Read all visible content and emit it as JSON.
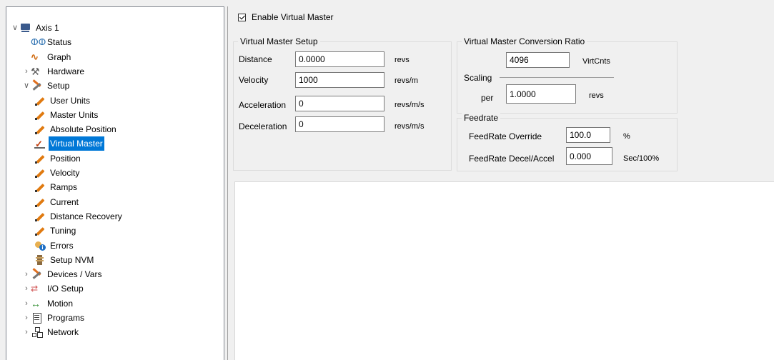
{
  "tree": {
    "items": [
      {
        "label": "Axis 1",
        "chevron": "expanded",
        "icon": "axis-icon"
      },
      {
        "label": "Status",
        "chevron": "",
        "icon": "glasses-icon"
      },
      {
        "label": "Graph",
        "chevron": "",
        "icon": "graph-icon"
      },
      {
        "label": "Hardware",
        "chevron": "collapsed",
        "icon": "hardware-icon"
      },
      {
        "label": "Setup",
        "chevron": "expanded",
        "icon": "setup-tools-icon"
      },
      {
        "label": "User Units",
        "chevron": "",
        "icon": "pen-icon"
      },
      {
        "label": "Master Units",
        "chevron": "",
        "icon": "pen-icon"
      },
      {
        "label": "Absolute Position",
        "chevron": "",
        "icon": "pen-icon"
      },
      {
        "label": "Virtual Master",
        "chevron": "",
        "icon": "virtual-master-icon",
        "selected": true
      },
      {
        "label": "Position",
        "chevron": "",
        "icon": "pen-icon"
      },
      {
        "label": "Velocity",
        "chevron": "",
        "icon": "pen-icon"
      },
      {
        "label": "Ramps",
        "chevron": "",
        "icon": "pen-icon"
      },
      {
        "label": "Current",
        "chevron": "",
        "icon": "pen-icon"
      },
      {
        "label": "Distance Recovery",
        "chevron": "",
        "icon": "pen-icon"
      },
      {
        "label": "Tuning",
        "chevron": "",
        "icon": "pen-icon"
      },
      {
        "label": "Errors",
        "chevron": "",
        "icon": "errors-info-icon"
      },
      {
        "label": "Setup NVM",
        "chevron": "",
        "icon": "nvm-icon"
      },
      {
        "label": "Devices / Vars",
        "chevron": "collapsed",
        "icon": "setup-tools-icon"
      },
      {
        "label": "I/O Setup",
        "chevron": "collapsed",
        "icon": "io-icon"
      },
      {
        "label": "Motion",
        "chevron": "collapsed",
        "icon": "motion-arrows-icon"
      },
      {
        "label": "Programs",
        "chevron": "collapsed",
        "icon": "programs-icon"
      },
      {
        "label": "Network",
        "chevron": "collapsed",
        "icon": "network-icon"
      }
    ]
  },
  "enable_virtual_master": {
    "label": "Enable Virtual Master",
    "checked": true
  },
  "setup": {
    "title": "Virtual Master Setup",
    "distance": {
      "label": "Distance",
      "value": "0.0000",
      "unit": "revs"
    },
    "velocity": {
      "label": "Velocity",
      "value": "1000",
      "unit": "revs/m"
    },
    "acceleration": {
      "label": "Acceleration",
      "value": "0",
      "unit": "revs/m/s"
    },
    "deceleration": {
      "label": "Deceleration",
      "value": "0",
      "unit": "revs/m/s"
    }
  },
  "conversion": {
    "title": "Virtual Master Conversion Ratio",
    "numerator": {
      "value": "4096",
      "unit": "VirtCnts"
    },
    "scaling_label": "Scaling",
    "per_label": "per",
    "denominator": {
      "value": "1.0000",
      "unit": "revs"
    }
  },
  "feedrate": {
    "title": "Feedrate",
    "override": {
      "label": "FeedRate Override",
      "value": "100.0",
      "unit": "%"
    },
    "decel_accel": {
      "label": "FeedRate Decel/Accel",
      "value": "0.000",
      "unit": "Sec/100%"
    }
  }
}
